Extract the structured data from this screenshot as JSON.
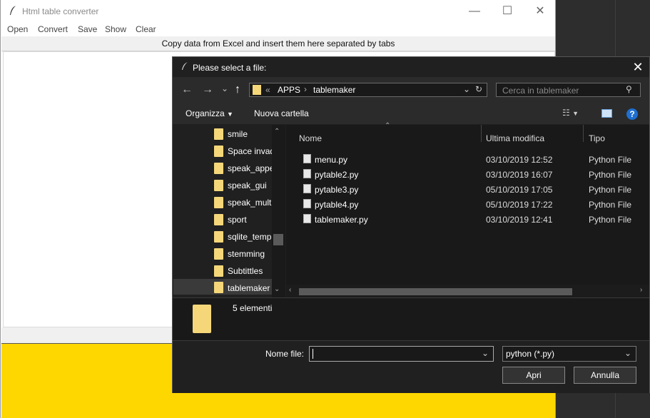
{
  "main_window": {
    "title": "Html table converter",
    "controls": [
      "—",
      "☐",
      "✕"
    ],
    "menu": [
      "Open",
      "Convert",
      "Save",
      "Show",
      "Clear"
    ],
    "hint": "Copy data from Excel and insert them here separated by tabs",
    "bottom_color": "#ffd700"
  },
  "dialog": {
    "title": "Please select a file:",
    "nav": {
      "back": "←",
      "forward": "→",
      "dropdown": "⌄",
      "up": "↑"
    },
    "address": {
      "prefix": "«",
      "crumbs": [
        "APPS",
        "tablemaker"
      ]
    },
    "search_placeholder": "Cerca in tablemaker",
    "toolbar": {
      "organize": "Organizza",
      "new_folder": "Nuova cartella"
    },
    "folders": [
      "smile",
      "Space invad",
      "speak_appe",
      "speak_gui",
      "speak_multi",
      "sport",
      "sqlite_temp",
      "stemming",
      "Subtittles",
      "tablemaker"
    ],
    "columns": {
      "name": "Nome",
      "modified": "Ultima modifica",
      "type": "Tipo"
    },
    "files": [
      {
        "name": "menu.py",
        "modified": "03/10/2019 12:52",
        "type": "Python File"
      },
      {
        "name": "pytable2.py",
        "modified": "03/10/2019 16:07",
        "type": "Python File"
      },
      {
        "name": "pytable3.py",
        "modified": "05/10/2019 17:05",
        "type": "Python File"
      },
      {
        "name": "pytable4.py",
        "modified": "05/10/2019 17:22",
        "type": "Python File"
      },
      {
        "name": "tablemaker.py",
        "modified": "03/10/2019 12:41",
        "type": "Python File"
      }
    ],
    "status": "5 elementi",
    "filename_label": "Nome file:",
    "filename_value": "",
    "filetype": "python (*.py)",
    "open_button": "Apri",
    "cancel_button": "Annulla"
  }
}
